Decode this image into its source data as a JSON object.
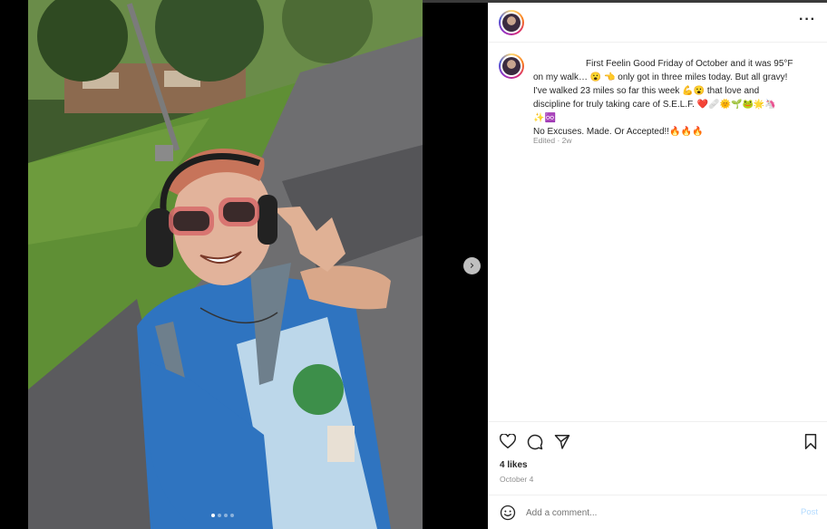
{
  "post": {
    "caption_lines": [
      "First Feelin Good Friday of October and it was 95°F",
      "on my walk… 😮 👈 only got in three miles today. But all gravy!",
      "I've walked 23 miles so far this week 💪😮 that love and",
      "discipline for truly taking care of S.E.L.F. ❤️🩹🌞🌱🐸🌟🦄",
      "✨♾️",
      "No Excuses. Made. Or Accepted!!🔥🔥🔥"
    ],
    "edited": "Edited · 2w",
    "likes": "4 likes",
    "date": "October 4"
  },
  "comment": {
    "placeholder": "Add a comment...",
    "post_label": "Post"
  },
  "icons": {
    "more": "more-options-icon",
    "like": "heart-icon",
    "comment": "comment-icon",
    "share": "send-icon",
    "save": "bookmark-icon",
    "next": "chevron-right-icon",
    "emoji": "smiley-icon"
  },
  "carousel": {
    "count": 4,
    "active_index": 1
  },
  "colors": {
    "link_blue": "#b3dbff",
    "muted": "#8e8e8e",
    "text": "#262626"
  }
}
